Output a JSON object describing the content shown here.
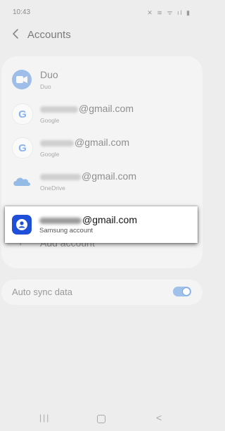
{
  "status_bar": {
    "time": "10:43",
    "icons": "✕ ≋ ᯤ ıl ▮"
  },
  "app_bar": {
    "back_icon": "chevron-left-icon",
    "title": "Accounts"
  },
  "accounts": [
    {
      "primary": "Duo",
      "secondary": "Duo",
      "icon": "duo-icon"
    },
    {
      "primary": "@gmail.com",
      "secondary": "Google",
      "icon": "google-icon"
    },
    {
      "primary": "@gmail.com",
      "secondary": "Google",
      "icon": "google-icon"
    },
    {
      "primary": "@gmail.com",
      "secondary": "OneDrive",
      "icon": "onedrive-icon"
    }
  ],
  "highlighted_account": {
    "primary": "@gmail.com",
    "secondary": "Samsung account",
    "icon": "samsung-account-icon"
  },
  "add_account": {
    "label": "Add account"
  },
  "sync": {
    "label": "Auto sync data",
    "enabled": true
  },
  "colors": {
    "accent": "#1f4fd8",
    "background": "#ededed",
    "card": "#f4f4f4"
  }
}
